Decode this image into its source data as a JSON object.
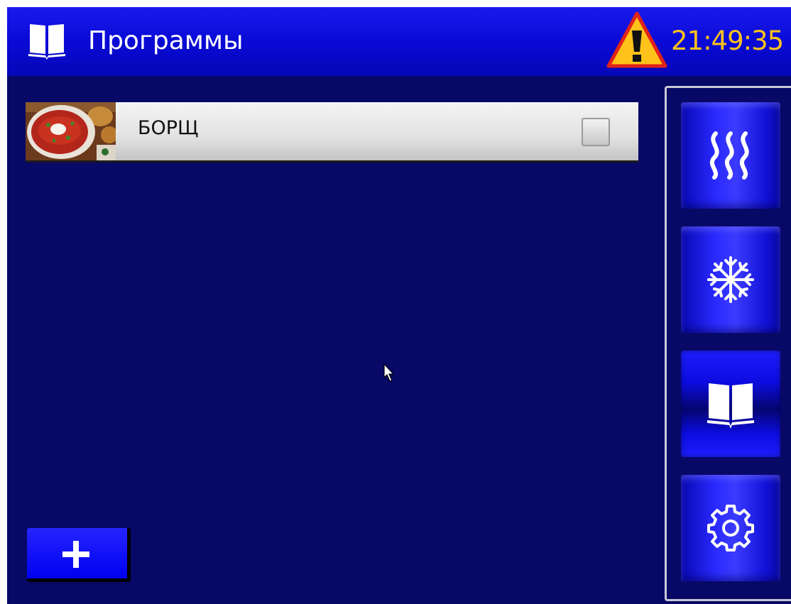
{
  "header": {
    "title": "Программы",
    "book_icon": "open-book-icon",
    "warning_icon": "warning-triangle-icon",
    "clock": "21:49:35",
    "clock_color": "#ffc21a",
    "background_color": "#0a0ad6"
  },
  "programs": [
    {
      "name": "БОРЩ",
      "thumbnail": "borscht-soup-photo",
      "checked": false
    }
  ],
  "add_button": {
    "icon": "plus-icon"
  },
  "nav": {
    "items": [
      {
        "id": "heating",
        "icon": "heat-waves-icon",
        "active": false
      },
      {
        "id": "cooling",
        "icon": "snowflake-icon",
        "active": false
      },
      {
        "id": "programs",
        "icon": "open-book-icon",
        "active": true
      },
      {
        "id": "settings",
        "icon": "gear-icon",
        "active": false
      }
    ]
  },
  "colors": {
    "screen_background": "#080866",
    "accent_blue": "#0000f0",
    "warning_yellow": "#ffc21a",
    "warning_red": "#e0221a"
  }
}
